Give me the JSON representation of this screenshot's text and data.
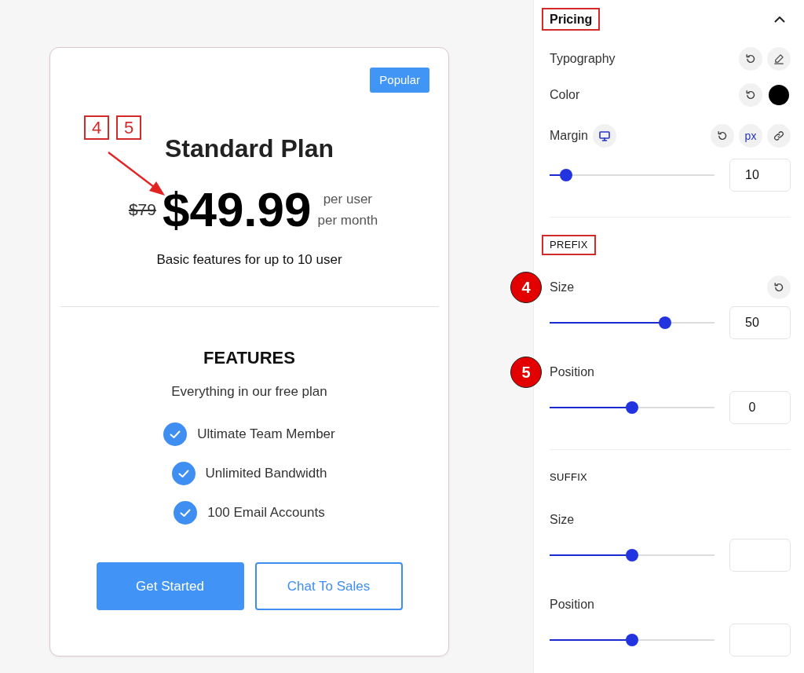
{
  "card": {
    "badge": "Popular",
    "callouts": [
      "4",
      "5"
    ],
    "title": "Standard Plan",
    "old_price": "$79",
    "price": "$49.99",
    "period": [
      "per user",
      "per month"
    ],
    "subtitle": "Basic features for up to 10 user",
    "features_heading": "FEATURES",
    "features_intro": "Everything in our free plan",
    "features": [
      "Ultimate Team Member",
      "Unlimited Bandwidth",
      "100 Email Accounts"
    ],
    "buttons": [
      {
        "label": "Get Started",
        "kind": "primary"
      },
      {
        "label": "Chat To Sales",
        "kind": "outline"
      }
    ]
  },
  "panel": {
    "section": {
      "title": "Pricing",
      "highlighted": true,
      "expanded": true
    },
    "rows": [
      {
        "kind": "typography",
        "label": "Typography"
      },
      {
        "kind": "color",
        "label": "Color",
        "color": "#000000"
      },
      {
        "kind": "dimension",
        "label": "Margin",
        "unit": "px",
        "level": 0.1,
        "value": "10"
      }
    ],
    "groups": [
      {
        "title": "PREFIX",
        "highlighted": true,
        "controls": [
          {
            "label": "Size",
            "callout": "4",
            "modified": true,
            "level": 0.7,
            "value": "50"
          },
          {
            "label": "Position",
            "callout": "5",
            "modified": false,
            "level": 0.5,
            "value": "0"
          }
        ]
      },
      {
        "title": "SUFFIX",
        "highlighted": false,
        "controls": [
          {
            "label": "Size",
            "modified": false,
            "level": 0.5
          },
          {
            "label": "Position",
            "modified": false,
            "level": 0.5
          }
        ]
      }
    ]
  }
}
